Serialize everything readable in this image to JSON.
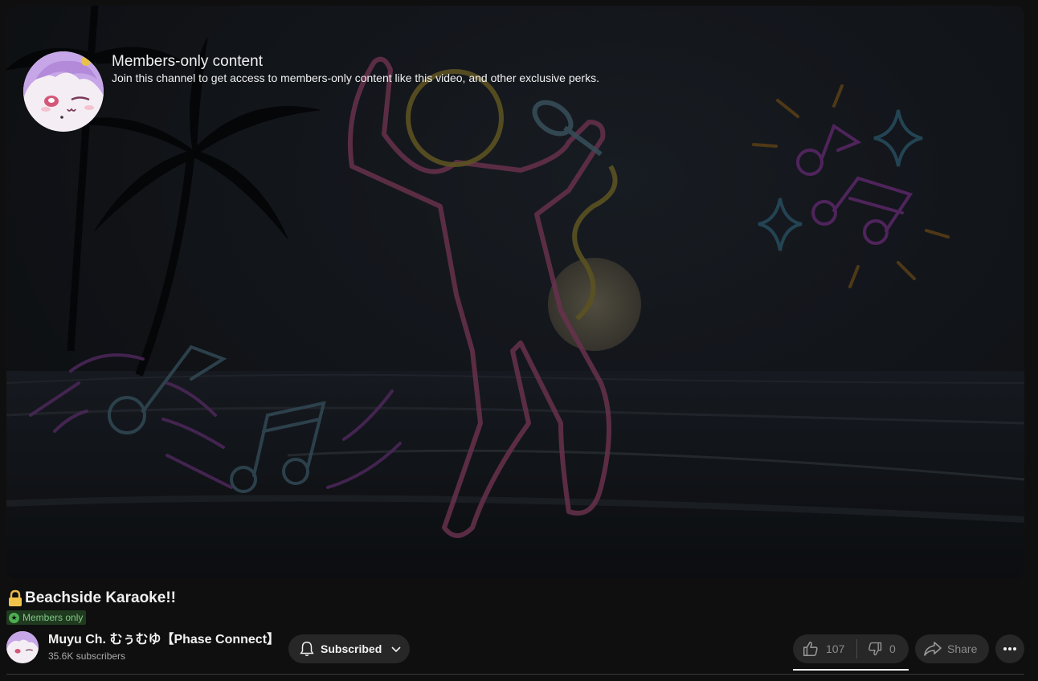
{
  "overlay": {
    "title": "Members-only content",
    "description": "Join this channel to get access to members-only content like this video, and other exclusive perks."
  },
  "video": {
    "title": "Beachside Karaoke!!",
    "badge": "Members only"
  },
  "channel": {
    "name": "Muyu Ch. むぅむゆ【Phase Connect】",
    "subscribers": "35.6K subscribers"
  },
  "actions": {
    "subscribe_label": "Subscribed",
    "likes": "107",
    "dislikes": "0",
    "share_label": "Share"
  },
  "icons": [
    "lock-icon",
    "bell-icon",
    "chevron-down-icon",
    "thumbs-up-icon",
    "thumbs-down-icon",
    "share-icon",
    "more-icon",
    "star-icon"
  ],
  "colors": {
    "background": "#0f0f0f",
    "button": "#272727",
    "badge_bg": "#1f3a1f",
    "badge_text": "#81c784",
    "neon_pink": "#c05a9a",
    "neon_yellow": "#c9b43a",
    "neon_blue": "#6aa8c8",
    "neon_orange": "#d58a2a"
  }
}
